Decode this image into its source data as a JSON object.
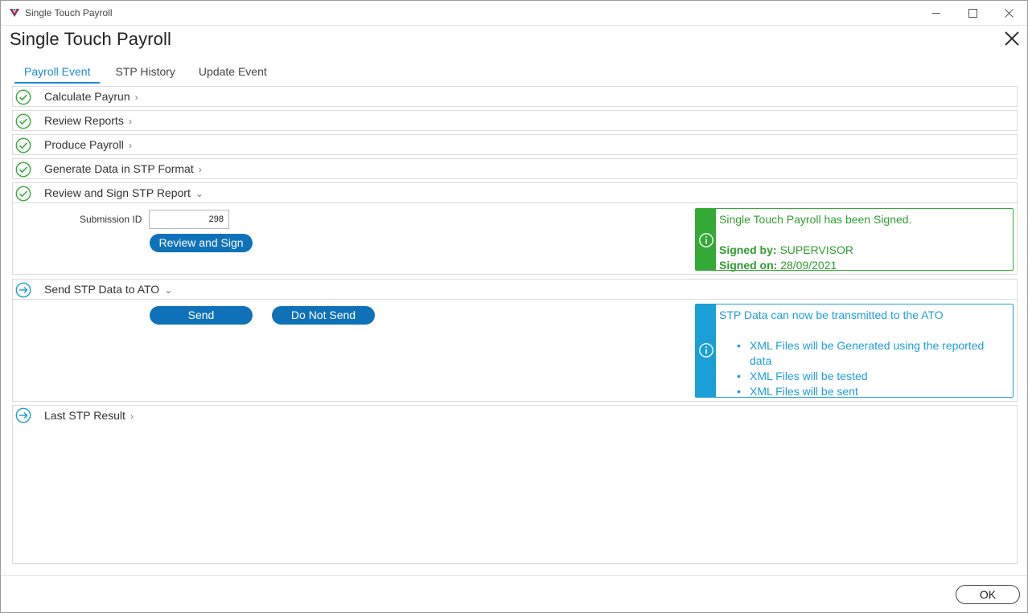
{
  "window": {
    "title": "Single Touch Payroll"
  },
  "header": {
    "title": "Single Touch Payroll"
  },
  "tabs": [
    {
      "label": "Payroll Event",
      "active": true
    },
    {
      "label": "STP History",
      "active": false
    },
    {
      "label": "Update Event",
      "active": false
    }
  ],
  "steps": {
    "calculate_payrun": {
      "label": "Calculate Payrun",
      "status": "complete",
      "icon": "check-circle-icon"
    },
    "review_reports": {
      "label": "Review Reports",
      "status": "complete",
      "icon": "check-circle-icon"
    },
    "produce_payroll": {
      "label": "Produce Payroll",
      "status": "complete",
      "icon": "check-circle-icon"
    },
    "generate_data": {
      "label": "Generate Data in STP Format",
      "status": "complete",
      "icon": "check-circle-icon"
    },
    "review_sign": {
      "label": "Review and Sign STP Report",
      "status": "complete",
      "icon": "check-circle-icon",
      "expanded": true
    },
    "send_stp": {
      "label": "Send STP Data to ATO",
      "status": "current",
      "icon": "arrow-circle-icon",
      "expanded": true
    },
    "last_result": {
      "label": "Last STP Result",
      "status": "current",
      "icon": "arrow-circle-icon"
    }
  },
  "review_sign_panel": {
    "submission_label": "Submission ID",
    "submission_value": "298",
    "button_label": "Review and Sign",
    "notice": {
      "headline": "Single Touch Payroll has been Signed.",
      "signed_by_label": "Signed by:",
      "signed_by_value": "SUPERVISOR",
      "signed_on_label": "Signed on:",
      "signed_on_value": "28/09/2021",
      "color": "#35a936"
    }
  },
  "send_panel": {
    "send_label": "Send",
    "do_not_send_label": "Do Not Send",
    "notice": {
      "headline": "STP Data can now be transmitted to the ATO",
      "bullets": [
        "XML Files will be Generated using the reported data",
        "XML Files will be tested",
        "XML Files will be sent"
      ],
      "color": "#1aa0d6"
    }
  },
  "footer": {
    "ok_label": "OK"
  },
  "colors": {
    "accent": "#1a8bd0",
    "button": "#0f72b9",
    "success": "#35a936",
    "info": "#1aa0d6"
  }
}
